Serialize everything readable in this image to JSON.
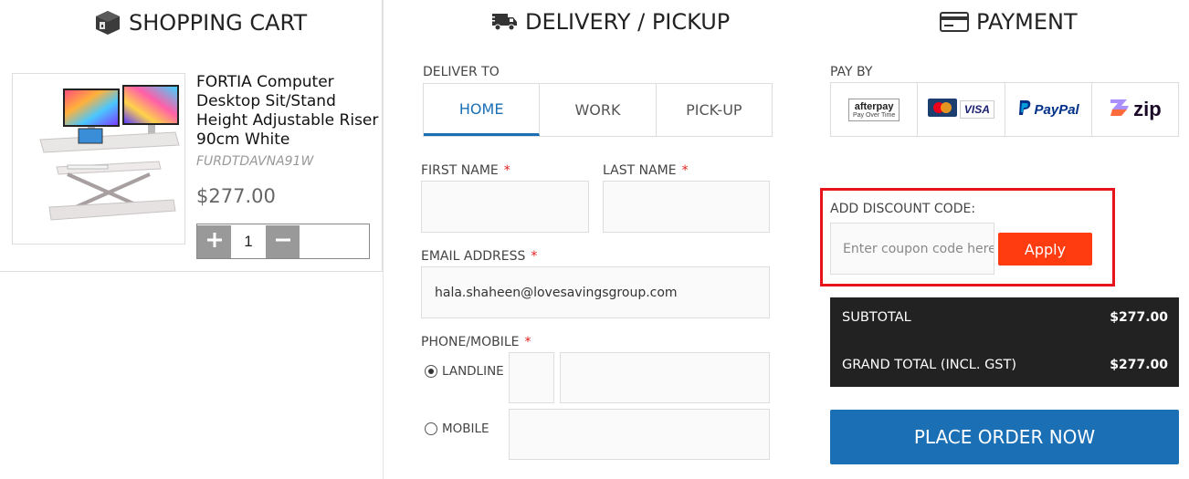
{
  "cart": {
    "title": "SHOPPING CART",
    "product": {
      "name": "FORTIA Computer Desktop Sit/Stand Height Adjustable Riser 90cm White",
      "sku": "FURDTDAVNA91W",
      "price": "$277.00",
      "quantity": "1"
    }
  },
  "delivery": {
    "title": "DELIVERY / PICKUP",
    "deliver_to_label": "DELIVER TO",
    "tabs": [
      {
        "label": "HOME",
        "active": true
      },
      {
        "label": "WORK",
        "active": false
      },
      {
        "label": "PICK-UP",
        "active": false
      }
    ],
    "first_name_label": "FIRST NAME",
    "last_name_label": "LAST NAME",
    "email_label": "EMAIL ADDRESS",
    "email_value": "hala.shaheen@lovesavingsgroup.com",
    "phone_label": "PHONE/MOBILE",
    "landline_label": "LANDLINE",
    "mobile_label": "MOBILE",
    "required_mark": "*",
    "selected_phone_type": "LANDLINE"
  },
  "payment": {
    "title": "PAYMENT",
    "pay_by_label": "PAY BY",
    "methods": [
      "afterpay",
      "mastercard-visa",
      "paypal",
      "zip"
    ],
    "afterpay_text": "afterpay",
    "afterpay_sub": "Pay Over Time",
    "visa_text": "VISA",
    "paypal_text": "PayPal",
    "zip_text": "zip",
    "discount_label": "ADD DISCOUNT CODE:",
    "coupon_placeholder": "Enter coupon code here",
    "apply_label": "Apply",
    "subtotal_label": "SUBTOTAL",
    "subtotal_value": "$277.00",
    "grand_total_label": "GRAND TOTAL (INCL. GST)",
    "grand_total_value": "$277.00",
    "place_order_label": "PLACE ORDER NOW"
  },
  "colors": {
    "accent_blue": "#1a6fb5",
    "apply_red": "#ff3b10",
    "highlight_border": "#e8141b",
    "totals_bg": "#222222"
  },
  "icons": [
    "box-icon",
    "truck-icon",
    "credit-card-icon",
    "plus-icon",
    "minus-icon"
  ]
}
